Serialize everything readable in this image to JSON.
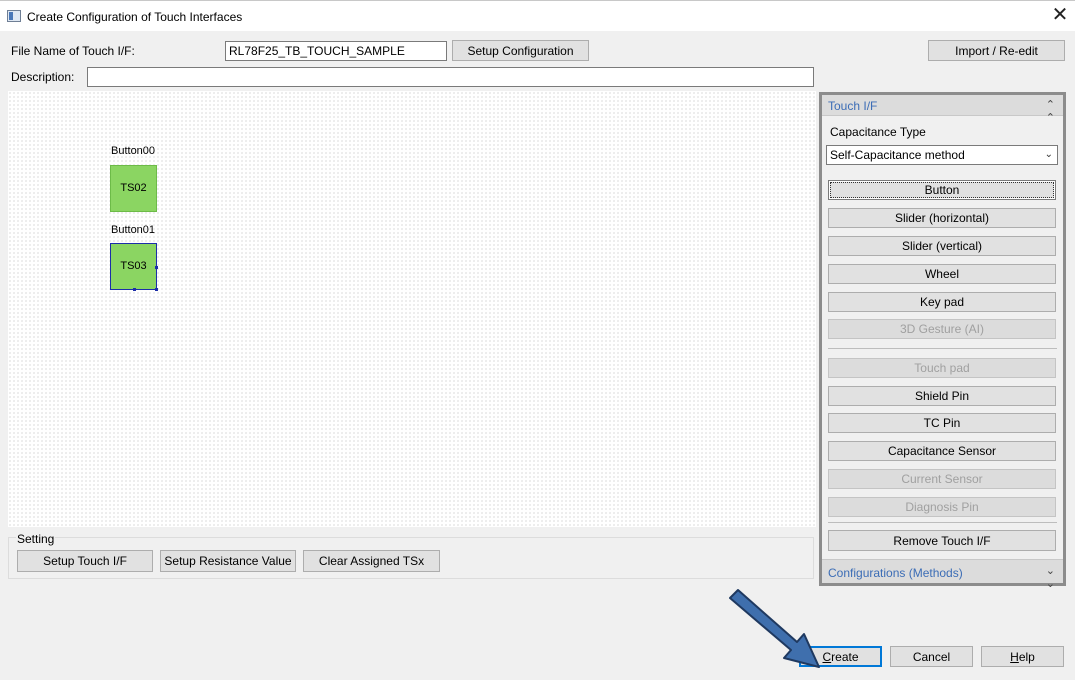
{
  "window": {
    "title": "Create Configuration of Touch Interfaces",
    "close_glyph": "✕"
  },
  "header": {
    "file_name_label": "File Name of Touch I/F:",
    "file_name_value": "RL78F25_TB_TOUCH_SAMPLE",
    "setup_configuration_label": "Setup Configuration",
    "import_reedit_label": "Import / Re-edit",
    "description_label": "Description:",
    "description_value": ""
  },
  "canvas": {
    "buttons": [
      {
        "name": "Button00",
        "sensor": "TS02",
        "color": "#8bd562"
      },
      {
        "name": "Button01",
        "sensor": "TS03",
        "color": "#8bd562",
        "selected": true
      }
    ]
  },
  "setting": {
    "group_label": "Setting",
    "setup_touch_if_label": "Setup Touch I/F",
    "setup_resistance_label": "Setup Resistance Value",
    "clear_assigned_label": "Clear Assigned TSx"
  },
  "touch_panel": {
    "header": "Touch I/F",
    "header_icon": "chevron-double-up-icon",
    "capacitance_type_label": "Capacitance Type",
    "capacitance_type_value": "Self-Capacitance method",
    "buttons": [
      {
        "label": "Button",
        "enabled": true
      },
      {
        "label": "Slider (horizontal)",
        "enabled": true
      },
      {
        "label": "Slider (vertical)",
        "enabled": true
      },
      {
        "label": "Wheel",
        "enabled": true
      },
      {
        "label": "Key pad",
        "enabled": true
      },
      {
        "label": "3D Gesture (AI)",
        "enabled": false
      },
      {
        "label": "Touch pad",
        "enabled": false
      },
      {
        "label": "Shield Pin",
        "enabled": true
      },
      {
        "label": "TC Pin",
        "enabled": true
      },
      {
        "label": "Capacitance Sensor",
        "enabled": true
      },
      {
        "label": "Current Sensor",
        "enabled": false
      },
      {
        "label": "Diagnosis Pin",
        "enabled": false
      }
    ],
    "remove_label": "Remove Touch I/F",
    "footer": "Configurations (Methods)",
    "footer_icon": "chevron-double-down-icon"
  },
  "footer": {
    "create_mnemonic": "C",
    "create_rest": "reate",
    "cancel_label": "Cancel",
    "help_mnemonic": "H",
    "help_rest": "elp"
  },
  "colors": {
    "accent_blue": "#3c6db6",
    "annotation_arrow": "#3f6fad",
    "tile_green": "#8bd562",
    "selection_blue": "#1c2ea8"
  }
}
